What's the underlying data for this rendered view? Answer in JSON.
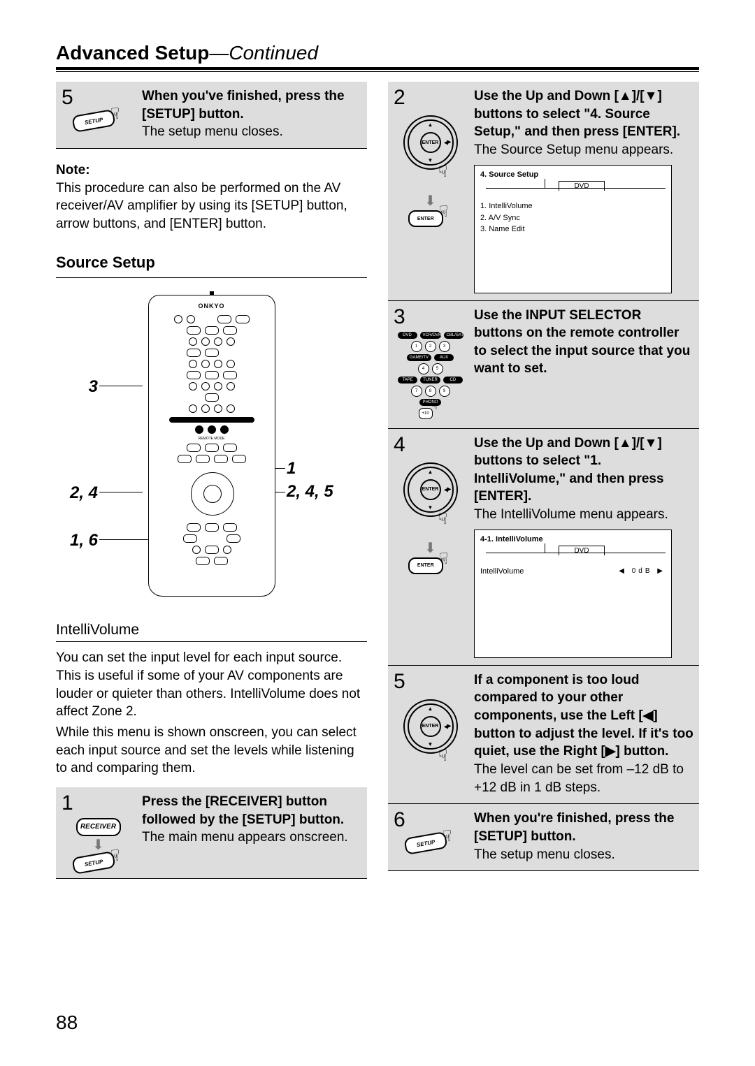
{
  "header": {
    "bold": "Advanced Setup",
    "italic": "—Continued"
  },
  "left": {
    "step5": {
      "num": "5",
      "bold": "When you've finished, press the [SETUP] button.",
      "body": "The setup menu closes.",
      "btn": "SETUP"
    },
    "note": {
      "label": "Note:",
      "body": "This procedure can also be performed on the AV receiver/AV amplifier by using its [SETUP] button, arrow buttons, and [ENTER] button."
    },
    "section": "Source Setup",
    "remote": {
      "brand": "ONKYO",
      "callouts": {
        "c3": "3",
        "c24": "2, 4",
        "c16": "1, 6",
        "c1": "1",
        "c245": "2, 4, 5"
      }
    },
    "subheading": "IntelliVolume",
    "intelli_body1": "You can set the input level for each input source. This is useful if some of your AV components are louder or quieter than others. IntelliVolume does not affect Zone 2.",
    "intelli_body2": "While this menu is shown onscreen, you can select each input source and set the levels while listening to and comparing them.",
    "step1": {
      "num": "1",
      "bold": "Press the [RECEIVER] button followed by the [SETUP] button.",
      "body": "The main menu appears onscreen.",
      "btn1": "RECEIVER",
      "btn2": "SETUP"
    }
  },
  "right": {
    "step2": {
      "num": "2",
      "bold": "Use the Up and Down [▲]/[▼] buttons to select \"4. Source Setup,\" and then press [ENTER].",
      "body": "The Source Setup menu appears.",
      "enter": "ENTER",
      "enter2": "ENTER",
      "osd": {
        "title": "4.  Source Setup",
        "tab": "DVD",
        "items": [
          "1.  IntelliVolume",
          "2.  A/V Sync",
          "3.  Name Edit"
        ]
      }
    },
    "step3": {
      "num": "3",
      "bold": "Use the INPUT SELECTOR buttons on the remote controller to select the input source that you want to set.",
      "keys": {
        "row1": [
          "DVD",
          "VCR/DVR",
          "CBL/SAT"
        ],
        "row1n": [
          "1",
          "2",
          "3"
        ],
        "row2": [
          "GAME/TV",
          "AUX"
        ],
        "row2n": [
          "4",
          "5"
        ],
        "row3": [
          "TAPE",
          "TUNER",
          "CD"
        ],
        "row3n": [
          "7",
          "8",
          "9"
        ],
        "row4": [
          "PHONO"
        ],
        "row4n": [
          "+10"
        ]
      }
    },
    "step4": {
      "num": "4",
      "bold": "Use the Up and Down [▲]/[▼] buttons to select \"1. IntelliVolume,\" and then press [ENTER].",
      "body": "The IntelliVolume menu appears.",
      "enter": "ENTER",
      "enter2": "ENTER",
      "osd": {
        "title": "4-1. IntelliVolume",
        "tab": "DVD",
        "row_label": "IntelliVolume",
        "row_value": "0dB"
      }
    },
    "step5": {
      "num": "5",
      "bold": "If a component is too loud compared to your other components, use the Left [◀] button to adjust the level. If it's too quiet, use the Right [▶] button.",
      "body": "The level can be set from –12 dB to +12 dB in 1 dB steps.",
      "enter": "ENTER"
    },
    "step6": {
      "num": "6",
      "bold": "When you're finished, press the [SETUP] button.",
      "body": "The setup menu closes.",
      "btn": "SETUP"
    }
  },
  "page_number": "88"
}
